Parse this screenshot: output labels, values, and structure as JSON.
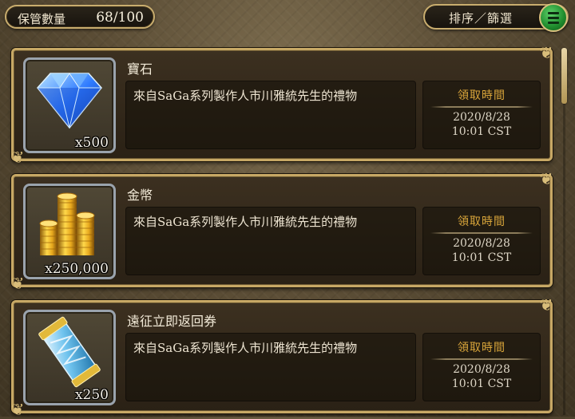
{
  "header": {
    "storage_label": "保管數量",
    "storage_count": "68/100",
    "sort_label": "排序／篩選",
    "menu_icon": "hamburger-menu-icon"
  },
  "items": [
    {
      "name": "寶石",
      "icon": "gem-icon",
      "quantity": "x500",
      "description": "來自SaGa系列製作人市川雅統先生的禮物",
      "time_label": "領取時間",
      "date": "2020/8/28",
      "time": "10:01 CST"
    },
    {
      "name": "金幣",
      "icon": "gold-coins-icon",
      "quantity": "x250,000",
      "description": "來自SaGa系列製作人市川雅統先生的禮物",
      "time_label": "領取時間",
      "date": "2020/8/28",
      "time": "10:01 CST"
    },
    {
      "name": "遠征立即返回券",
      "icon": "ticket-icon",
      "quantity": "x250",
      "description": "來自SaGa系列製作人市川雅統先生的禮物",
      "time_label": "領取時間",
      "date": "2020/8/28",
      "time": "10:01 CST"
    }
  ],
  "colors": {
    "frame_gold": "#c7a865",
    "time_label": "#d9a53a",
    "menu_green": "#1e8a2c"
  }
}
